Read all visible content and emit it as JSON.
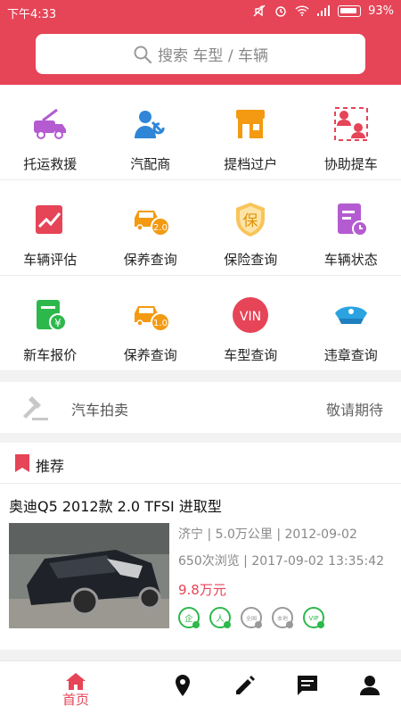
{
  "status_bar": {
    "time": "下午4:33",
    "battery": "93%"
  },
  "search": {
    "placeholder": "搜索 车型 / 车辆"
  },
  "grid": [
    {
      "label": "托运救援",
      "icon": "tow-truck-icon"
    },
    {
      "label": "汽配商",
      "icon": "parts-dealer-icon"
    },
    {
      "label": "提档过户",
      "icon": "store-icon"
    },
    {
      "label": "协助提车",
      "icon": "assist-pickup-icon"
    },
    {
      "label": "车辆评估",
      "icon": "evaluation-icon"
    },
    {
      "label": "保养查询",
      "icon": "maintenance-2-icon",
      "badge": "2.0"
    },
    {
      "label": "保险查询",
      "icon": "insurance-icon",
      "glyph": "保"
    },
    {
      "label": "车辆状态",
      "icon": "vehicle-status-icon"
    },
    {
      "label": "新车报价",
      "icon": "new-car-price-icon",
      "glyph": "¥"
    },
    {
      "label": "保养查询",
      "icon": "maintenance-1-icon",
      "badge": "1.0"
    },
    {
      "label": "车型查询",
      "icon": "vin-icon",
      "glyph": "VIN"
    },
    {
      "label": "违章查询",
      "icon": "police-cap-icon"
    }
  ],
  "auction": {
    "title": "汽车拍卖",
    "status": "敬请期待"
  },
  "recommend": {
    "title": "推荐",
    "car": {
      "name": "奥迪Q5 2012款 2.0 TFSI 进取型",
      "meta1": "济宁 | 5.0万公里 | 2012-09-02",
      "meta2": "650次浏览 | 2017-09-02 13:35:42",
      "price": "9.8万元",
      "badges": [
        {
          "text": "企",
          "active": true
        },
        {
          "text": "人",
          "active": true
        },
        {
          "text": "全国",
          "active": false
        },
        {
          "text": "本地",
          "active": false
        },
        {
          "text": "VIP",
          "active": true
        }
      ]
    }
  },
  "tabbar": {
    "home": "首页"
  },
  "colors": {
    "brand": "#e64457",
    "green": "#2db84b",
    "orange": "#f39a12",
    "purple": "#b45bd1",
    "blue": "#2f86d6"
  }
}
